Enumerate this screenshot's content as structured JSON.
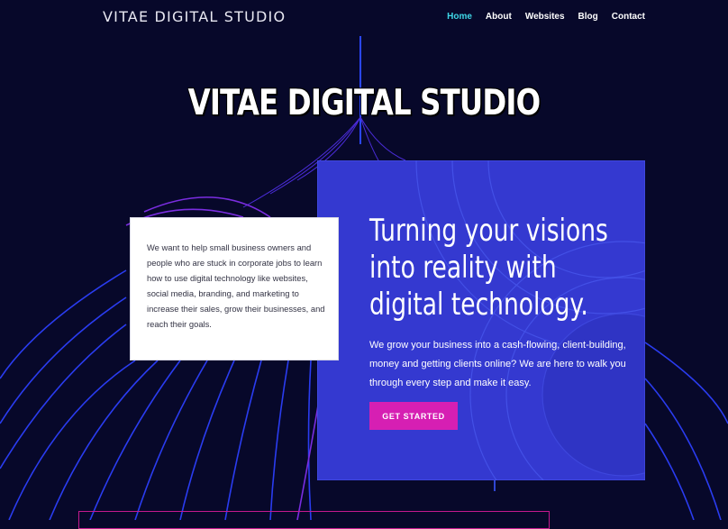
{
  "site": {
    "logo_text": "VITAE DIGITAL STUDIO"
  },
  "nav": {
    "items": [
      {
        "label": "Home",
        "active": true
      },
      {
        "label": "About",
        "active": false
      },
      {
        "label": "Websites",
        "active": false
      },
      {
        "label": "Blog",
        "active": false
      },
      {
        "label": "Contact",
        "active": false
      }
    ]
  },
  "hero": {
    "title": "VITAE DIGITAL STUDIO"
  },
  "intro_card": {
    "text": "We want to help small business owners and people who are stuck in corporate jobs to learn how to use digital technology like websites, social media, branding, and marketing to increase their sales, grow their businesses, and reach their goals."
  },
  "feature_card": {
    "heading_lines": [
      "Turning your visions",
      "into reality with",
      "digital technology."
    ],
    "body": "We grow your business into a cash-flowing, client-building, money and getting clients online? We are here to walk you through every step and make it easy.",
    "cta_label": "GET STARTED"
  },
  "colors": {
    "background": "#07082a",
    "nav_active": "#3fd7e6",
    "card_blue": "#3439d0",
    "cta_magenta": "#d61fb3",
    "line_blue": "#2a3cf0",
    "line_purple": "#7a2de0"
  }
}
